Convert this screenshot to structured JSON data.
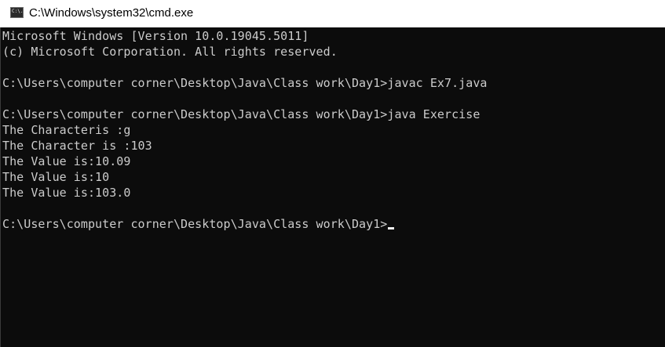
{
  "window": {
    "title": "C:\\Windows\\system32\\cmd.exe",
    "icon_name": "cmd-icon",
    "icon_label": "C:\\.",
    "background": "#0c0c0c",
    "text_color": "#cccccc"
  },
  "console": {
    "lines": [
      "Microsoft Windows [Version 10.0.19045.5011]",
      "(c) Microsoft Corporation. All rights reserved.",
      "",
      "C:\\Users\\computer corner\\Desktop\\Java\\Class work\\Day1>javac Ex7.java",
      "",
      "C:\\Users\\computer corner\\Desktop\\Java\\Class work\\Day1>java Exercise",
      "The Characteris :g",
      "The Character is :103",
      "The Value is:10.09",
      "The Value is:10",
      "The Value is:103.0",
      "",
      "C:\\Users\\computer corner\\Desktop\\Java\\Class work\\Day1>"
    ]
  }
}
